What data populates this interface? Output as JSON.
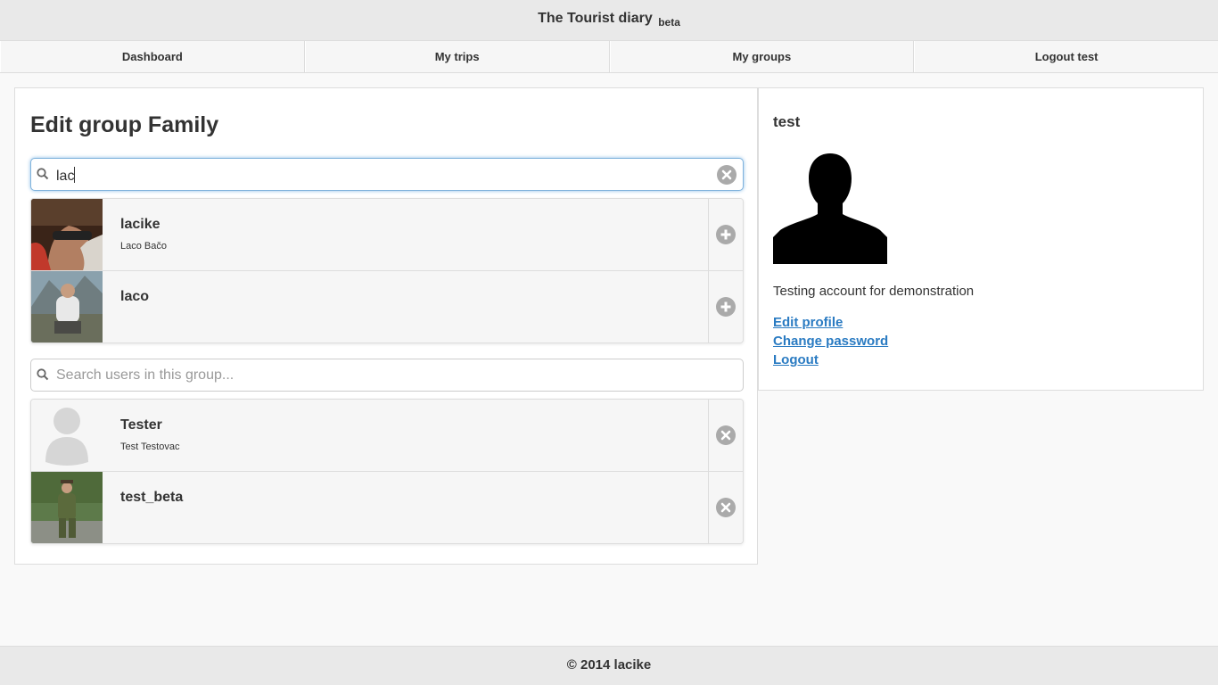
{
  "header": {
    "title": "The Tourist diary",
    "badge": "beta"
  },
  "nav": {
    "items": [
      {
        "label": "Dashboard"
      },
      {
        "label": "My trips"
      },
      {
        "label": "My groups"
      },
      {
        "label": "Logout test"
      }
    ]
  },
  "main": {
    "title": "Edit group Family",
    "add_search": {
      "value": "lac",
      "placeholder": ""
    },
    "results": [
      {
        "name": "lacike",
        "fullname": "Laco Bačo",
        "action": "add-icon"
      },
      {
        "name": "laco",
        "fullname": "",
        "action": "add-icon"
      }
    ],
    "member_search": {
      "value": "",
      "placeholder": "Search users in this group..."
    },
    "members": [
      {
        "name": "Tester",
        "fullname": "Test Testovac",
        "action": "remove-icon"
      },
      {
        "name": "test_beta",
        "fullname": "",
        "action": "remove-icon"
      }
    ]
  },
  "sidebar": {
    "username": "test",
    "description": "Testing account for demonstration",
    "links": [
      "Edit profile",
      "Change password",
      "Logout"
    ]
  },
  "footer": {
    "text": "© 2014 lacike"
  },
  "colors": {
    "link": "#2a7bc2",
    "focus": "#7fb2dc",
    "icon": "#aaaaaa"
  }
}
